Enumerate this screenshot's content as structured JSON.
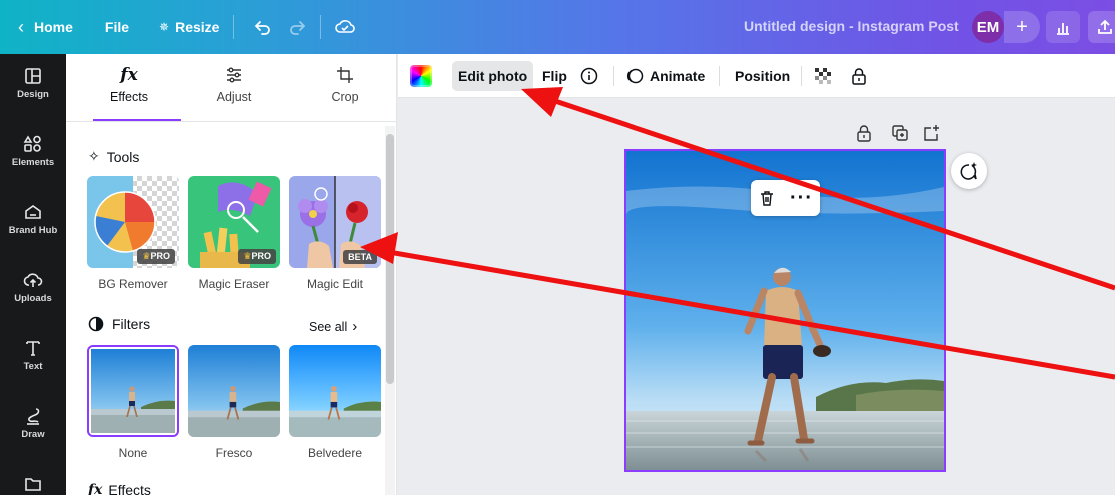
{
  "topbar": {
    "home_label": "Home",
    "file_label": "File",
    "resize_label": "Resize",
    "doc_title": "Untitled design - Instagram Post",
    "avatar_initials": "EM",
    "plus_label": "+"
  },
  "rail": {
    "items": [
      {
        "label": "Design",
        "icon": "layout-icon"
      },
      {
        "label": "Elements",
        "icon": "shapes-icon"
      },
      {
        "label": "Brand Hub",
        "icon": "brand-icon"
      },
      {
        "label": "Uploads",
        "icon": "upload-cloud-icon"
      },
      {
        "label": "Text",
        "icon": "text-icon"
      },
      {
        "label": "Draw",
        "icon": "draw-icon"
      },
      {
        "label": "",
        "icon": "folder-icon"
      }
    ]
  },
  "panel": {
    "tabs": [
      {
        "label": "Effects",
        "icon": "fx-icon"
      },
      {
        "label": "Adjust",
        "icon": "sliders-icon"
      },
      {
        "label": "Crop",
        "icon": "crop-icon"
      }
    ],
    "tools_title": "Tools",
    "tools": [
      {
        "label": "BG Remover",
        "badge": "PRO"
      },
      {
        "label": "Magic Eraser",
        "badge": "PRO"
      },
      {
        "label": "Magic Edit",
        "badge": "BETA"
      }
    ],
    "filters_title": "Filters",
    "see_all_label": "See all",
    "filters": [
      {
        "label": "None",
        "selected": true
      },
      {
        "label": "Fresco",
        "selected": false
      },
      {
        "label": "Belvedere",
        "selected": false
      }
    ],
    "effects_title": "Effects"
  },
  "context_toolbar": {
    "edit_photo_label": "Edit photo",
    "flip_label": "Flip",
    "animate_label": "Animate",
    "position_label": "Position"
  },
  "colors": {
    "accent": "#8b3dff",
    "annotation_arrow": "#ee1111",
    "rail_bg": "#18191b"
  }
}
